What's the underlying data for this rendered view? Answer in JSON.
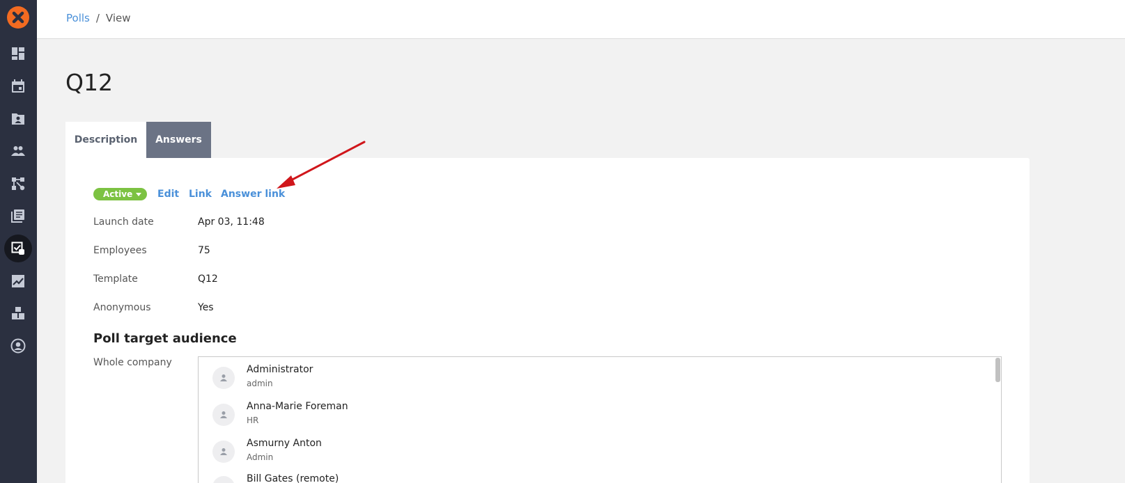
{
  "breadcrumb": {
    "parent": "Polls",
    "separator": "/",
    "current": "View"
  },
  "page": {
    "title": "Q12"
  },
  "tabs": [
    {
      "label": "Description",
      "active": true
    },
    {
      "label": "Answers",
      "active": false
    }
  ],
  "actions": {
    "status": "Active",
    "edit": "Edit",
    "link": "Link",
    "answer_link": "Answer link"
  },
  "fields": [
    {
      "label": "Launch date",
      "value": "Apr 03, 11:48"
    },
    {
      "label": "Employees",
      "value": "75"
    },
    {
      "label": "Template",
      "value": "Q12"
    },
    {
      "label": "Anonymous",
      "value": "Yes"
    }
  ],
  "audience": {
    "title": "Poll target audience",
    "scope_label": "Whole company",
    "people": [
      {
        "name": "Administrator",
        "role": "admin"
      },
      {
        "name": "Anna-Marie Foreman",
        "role": "HR"
      },
      {
        "name": "Asmurny Anton",
        "role": "Admin"
      },
      {
        "name": "Bill Gates (remote)",
        "role": ""
      }
    ]
  },
  "colors": {
    "sidebar": "#2b3040",
    "logo": "#f26b21",
    "link": "#4a90d9",
    "status_active": "#7cc242",
    "tab_inactive": "#6b7385",
    "annotation_arrow": "#d0161b"
  },
  "sidebar_icons": [
    "logo-icon",
    "dashboard-icon",
    "calendar-icon",
    "contacts-icon",
    "people-icon",
    "org-structure-icon",
    "library-icon",
    "polls-icon",
    "analytics-icon",
    "modules-icon",
    "profile-icon"
  ]
}
